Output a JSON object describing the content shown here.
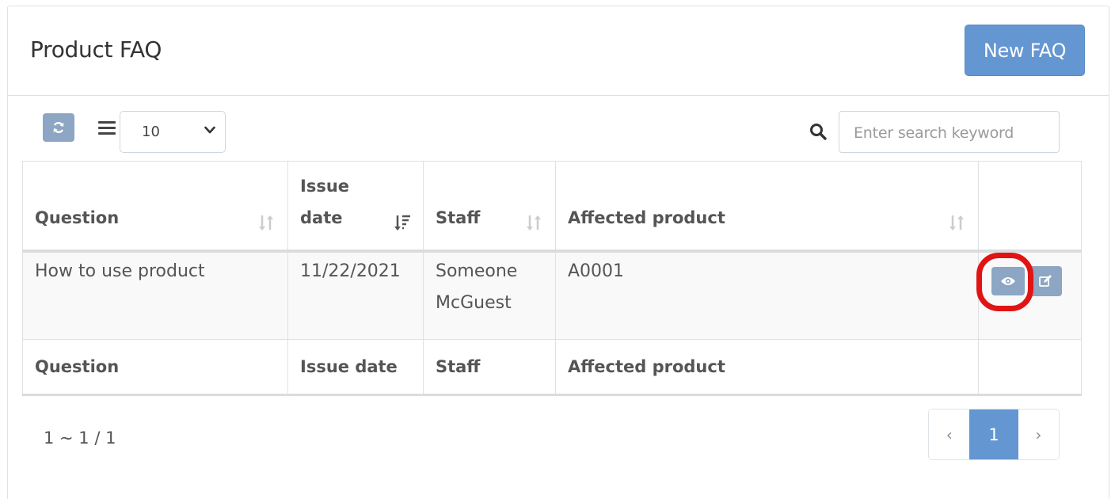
{
  "header": {
    "title": "Product FAQ",
    "new_button": "New FAQ"
  },
  "toolbar": {
    "page_size": "10",
    "search_placeholder": "Enter search keyword"
  },
  "table": {
    "columns": [
      "Question",
      "Issue date",
      "Staff",
      "Affected product"
    ],
    "header_lines": {
      "issue_date_1": "Issue",
      "issue_date_2": "date"
    },
    "rows": [
      {
        "question": "How to use product",
        "issue_date": "11/22/2021",
        "staff_1": "Someone",
        "staff_2": "McGuest",
        "affected_product": "A0001"
      }
    ],
    "sort": {
      "issue_date": "descending"
    }
  },
  "pagination": {
    "info": "1 ~ 1 / 1",
    "prev": "‹",
    "current": "1",
    "next": "›"
  },
  "colors": {
    "primary": "#6496d1",
    "icon_button": "#8ca6c3",
    "highlight": "#e01414"
  }
}
